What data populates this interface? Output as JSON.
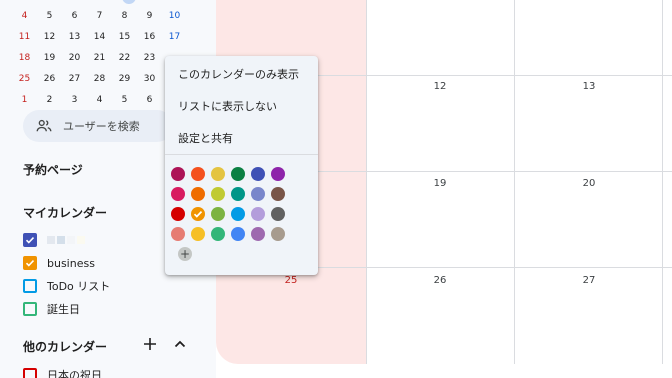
{
  "mini_calendar": {
    "rows": [
      [
        "4",
        "5",
        "6",
        "7",
        "8",
        "9",
        "10"
      ],
      [
        "11",
        "12",
        "13",
        "14",
        "15",
        "16",
        "17"
      ],
      [
        "18",
        "19",
        "20",
        "21",
        "22",
        "23",
        ""
      ],
      [
        "25",
        "26",
        "27",
        "28",
        "29",
        "30",
        ""
      ],
      [
        "1",
        "2",
        "3",
        "4",
        "5",
        "6",
        ""
      ]
    ]
  },
  "sidebar": {
    "search_users_label": "ユーザーを検索",
    "booking_pages_title": "予約ページ",
    "my_calendars_title": "マイカレンダー",
    "my_calendars": [
      {
        "label": "",
        "color": "#3f51b5",
        "checked": true
      },
      {
        "label": "business",
        "color": "#f09300",
        "checked": true
      },
      {
        "label": "ToDo リスト",
        "color": "#039be5",
        "checked": false
      },
      {
        "label": "誕生日",
        "color": "#33b679",
        "checked": false
      }
    ],
    "other_calendars_title": "他のカレンダー",
    "other_calendars": [
      {
        "label": "日本の祝日",
        "color": "#d50000",
        "checked": false
      }
    ]
  },
  "grid": {
    "week_rows": [
      [
        "",
        "",
        ""
      ],
      [
        "",
        "12",
        "13"
      ],
      [
        "",
        "19",
        "20"
      ],
      [
        "25",
        "26",
        "27"
      ]
    ]
  },
  "menu": {
    "items": [
      "このカレンダーのみ表示",
      "リストに表示しない",
      "設定と共有"
    ],
    "colors": [
      [
        "#ad1457",
        "#f4511e",
        "#e4c441",
        "#0b8043",
        "#3f51b5",
        "#8e24aa"
      ],
      [
        "#d81b60",
        "#ef6c00",
        "#c0ca33",
        "#009688",
        "#7986cb",
        "#795548"
      ],
      [
        "#d50000",
        "#f09300",
        "#7cb342",
        "#039be5",
        "#b39ddb",
        "#616161"
      ],
      [
        "#e67c73",
        "#f6bf26",
        "#33b679",
        "#4285f4",
        "#9e69af",
        "#a79b8e"
      ]
    ],
    "selected_color": "#f09300",
    "add_color_glyph": "+"
  }
}
